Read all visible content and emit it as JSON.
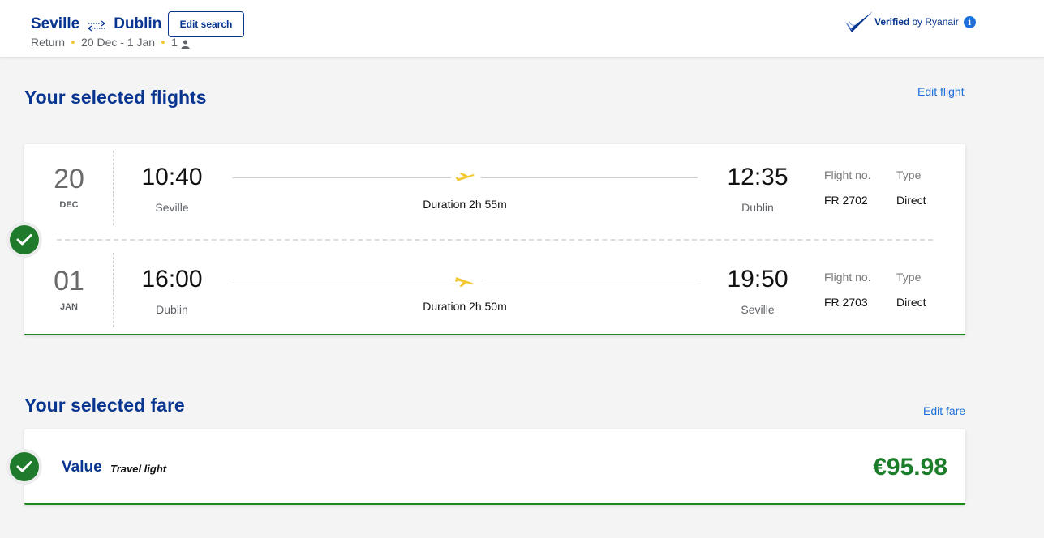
{
  "header": {
    "origin": "Seville",
    "destination": "Dublin",
    "edit_search_label": "Edit search",
    "trip_type": "Return",
    "dates": "20 Dec - 1 Jan",
    "passengers": "1",
    "verified_bold": "Verified",
    "verified_rest": "by Ryanair",
    "info_glyph": "i"
  },
  "flights_section": {
    "title": "Your selected flights",
    "edit_label": "Edit flight",
    "flights": [
      {
        "day": "20",
        "month": "DEC",
        "depart_time": "10:40",
        "depart_city": "Seville",
        "duration": "Duration 2h 55m",
        "arrive_time": "12:35",
        "arrive_city": "Dublin",
        "flight_no_label": "Flight no.",
        "flight_no": "FR 2702",
        "type_label": "Type",
        "type": "Direct"
      },
      {
        "day": "01",
        "month": "JAN",
        "depart_time": "16:00",
        "depart_city": "Dublin",
        "duration": "Duration 2h 50m",
        "arrive_time": "19:50",
        "arrive_city": "Seville",
        "flight_no_label": "Flight no.",
        "flight_no": "FR 2703",
        "type_label": "Type",
        "type": "Direct"
      }
    ]
  },
  "fare_section": {
    "title": "Your selected fare",
    "edit_label": "Edit fare",
    "fare_name": "Value",
    "fare_subtitle": "Travel light",
    "price": "€95.98"
  },
  "colors": {
    "brand_blue": "#073590",
    "link_blue": "#1e6fd9",
    "success_green": "#1f7a2c",
    "plane_yellow": "#f1c933"
  },
  "icons": [
    "swap-arrows-icon",
    "person-icon",
    "verified-check-icon",
    "info-icon",
    "plane-takeoff-icon",
    "plane-landing-icon",
    "checkmark-icon"
  ]
}
